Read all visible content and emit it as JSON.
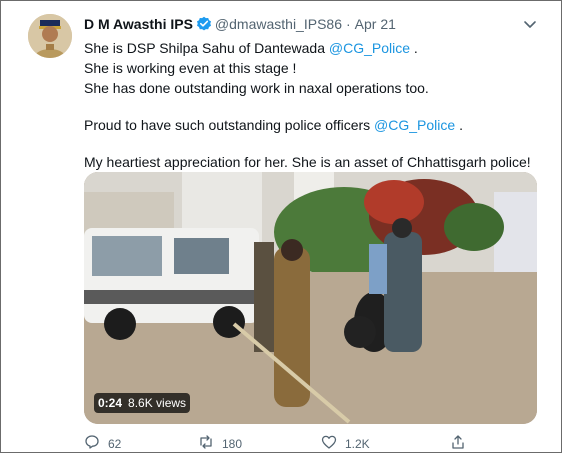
{
  "tweet": {
    "author_name": "D M Awasthi IPS",
    "handle": "@dmawasthi_IPS86",
    "separator": "·",
    "date": "Apr 21",
    "lines": [
      {
        "text": "She is DSP Shilpa Sahu of Dantewada ",
        "mention": "@CG_Police",
        "suffix": " ."
      },
      {
        "text": "She is working even at this stage !"
      },
      {
        "text": "She has done outstanding work in naxal operations too."
      },
      {
        "text": "Proud to have such outstanding police officers ",
        "mention": "@CG_Police",
        "suffix": " ."
      },
      {
        "text": "My heartiest appreciation for her. She is an asset of Chhattisgarh police!"
      }
    ]
  },
  "video": {
    "duration": "0:24",
    "views": "8.6K views"
  },
  "actions": {
    "replies": "62",
    "retweets": "180",
    "likes": "1.2K"
  },
  "colors": {
    "link": "#1b95e0",
    "muted": "#536471",
    "verified": "#1d9bf0"
  },
  "icons": [
    "verified-badge-icon",
    "more-options-icon",
    "reply-icon",
    "retweet-icon",
    "like-icon",
    "share-icon"
  ]
}
